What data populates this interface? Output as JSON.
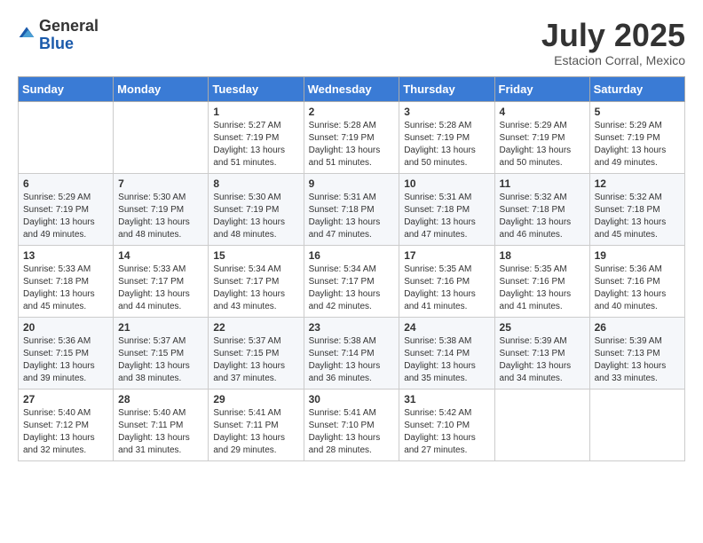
{
  "logo": {
    "general": "General",
    "blue": "Blue"
  },
  "title": "July 2025",
  "location": "Estacion Corral, Mexico",
  "weekdays": [
    "Sunday",
    "Monday",
    "Tuesday",
    "Wednesday",
    "Thursday",
    "Friday",
    "Saturday"
  ],
  "weeks": [
    [
      {
        "day": null,
        "info": ""
      },
      {
        "day": null,
        "info": ""
      },
      {
        "day": "1",
        "info": "Sunrise: 5:27 AM\nSunset: 7:19 PM\nDaylight: 13 hours and 51 minutes."
      },
      {
        "day": "2",
        "info": "Sunrise: 5:28 AM\nSunset: 7:19 PM\nDaylight: 13 hours and 51 minutes."
      },
      {
        "day": "3",
        "info": "Sunrise: 5:28 AM\nSunset: 7:19 PM\nDaylight: 13 hours and 50 minutes."
      },
      {
        "day": "4",
        "info": "Sunrise: 5:29 AM\nSunset: 7:19 PM\nDaylight: 13 hours and 50 minutes."
      },
      {
        "day": "5",
        "info": "Sunrise: 5:29 AM\nSunset: 7:19 PM\nDaylight: 13 hours and 49 minutes."
      }
    ],
    [
      {
        "day": "6",
        "info": "Sunrise: 5:29 AM\nSunset: 7:19 PM\nDaylight: 13 hours and 49 minutes."
      },
      {
        "day": "7",
        "info": "Sunrise: 5:30 AM\nSunset: 7:19 PM\nDaylight: 13 hours and 48 minutes."
      },
      {
        "day": "8",
        "info": "Sunrise: 5:30 AM\nSunset: 7:19 PM\nDaylight: 13 hours and 48 minutes."
      },
      {
        "day": "9",
        "info": "Sunrise: 5:31 AM\nSunset: 7:18 PM\nDaylight: 13 hours and 47 minutes."
      },
      {
        "day": "10",
        "info": "Sunrise: 5:31 AM\nSunset: 7:18 PM\nDaylight: 13 hours and 47 minutes."
      },
      {
        "day": "11",
        "info": "Sunrise: 5:32 AM\nSunset: 7:18 PM\nDaylight: 13 hours and 46 minutes."
      },
      {
        "day": "12",
        "info": "Sunrise: 5:32 AM\nSunset: 7:18 PM\nDaylight: 13 hours and 45 minutes."
      }
    ],
    [
      {
        "day": "13",
        "info": "Sunrise: 5:33 AM\nSunset: 7:18 PM\nDaylight: 13 hours and 45 minutes."
      },
      {
        "day": "14",
        "info": "Sunrise: 5:33 AM\nSunset: 7:17 PM\nDaylight: 13 hours and 44 minutes."
      },
      {
        "day": "15",
        "info": "Sunrise: 5:34 AM\nSunset: 7:17 PM\nDaylight: 13 hours and 43 minutes."
      },
      {
        "day": "16",
        "info": "Sunrise: 5:34 AM\nSunset: 7:17 PM\nDaylight: 13 hours and 42 minutes."
      },
      {
        "day": "17",
        "info": "Sunrise: 5:35 AM\nSunset: 7:16 PM\nDaylight: 13 hours and 41 minutes."
      },
      {
        "day": "18",
        "info": "Sunrise: 5:35 AM\nSunset: 7:16 PM\nDaylight: 13 hours and 41 minutes."
      },
      {
        "day": "19",
        "info": "Sunrise: 5:36 AM\nSunset: 7:16 PM\nDaylight: 13 hours and 40 minutes."
      }
    ],
    [
      {
        "day": "20",
        "info": "Sunrise: 5:36 AM\nSunset: 7:15 PM\nDaylight: 13 hours and 39 minutes."
      },
      {
        "day": "21",
        "info": "Sunrise: 5:37 AM\nSunset: 7:15 PM\nDaylight: 13 hours and 38 minutes."
      },
      {
        "day": "22",
        "info": "Sunrise: 5:37 AM\nSunset: 7:15 PM\nDaylight: 13 hours and 37 minutes."
      },
      {
        "day": "23",
        "info": "Sunrise: 5:38 AM\nSunset: 7:14 PM\nDaylight: 13 hours and 36 minutes."
      },
      {
        "day": "24",
        "info": "Sunrise: 5:38 AM\nSunset: 7:14 PM\nDaylight: 13 hours and 35 minutes."
      },
      {
        "day": "25",
        "info": "Sunrise: 5:39 AM\nSunset: 7:13 PM\nDaylight: 13 hours and 34 minutes."
      },
      {
        "day": "26",
        "info": "Sunrise: 5:39 AM\nSunset: 7:13 PM\nDaylight: 13 hours and 33 minutes."
      }
    ],
    [
      {
        "day": "27",
        "info": "Sunrise: 5:40 AM\nSunset: 7:12 PM\nDaylight: 13 hours and 32 minutes."
      },
      {
        "day": "28",
        "info": "Sunrise: 5:40 AM\nSunset: 7:11 PM\nDaylight: 13 hours and 31 minutes."
      },
      {
        "day": "29",
        "info": "Sunrise: 5:41 AM\nSunset: 7:11 PM\nDaylight: 13 hours and 29 minutes."
      },
      {
        "day": "30",
        "info": "Sunrise: 5:41 AM\nSunset: 7:10 PM\nDaylight: 13 hours and 28 minutes."
      },
      {
        "day": "31",
        "info": "Sunrise: 5:42 AM\nSunset: 7:10 PM\nDaylight: 13 hours and 27 minutes."
      },
      {
        "day": null,
        "info": ""
      },
      {
        "day": null,
        "info": ""
      }
    ]
  ]
}
